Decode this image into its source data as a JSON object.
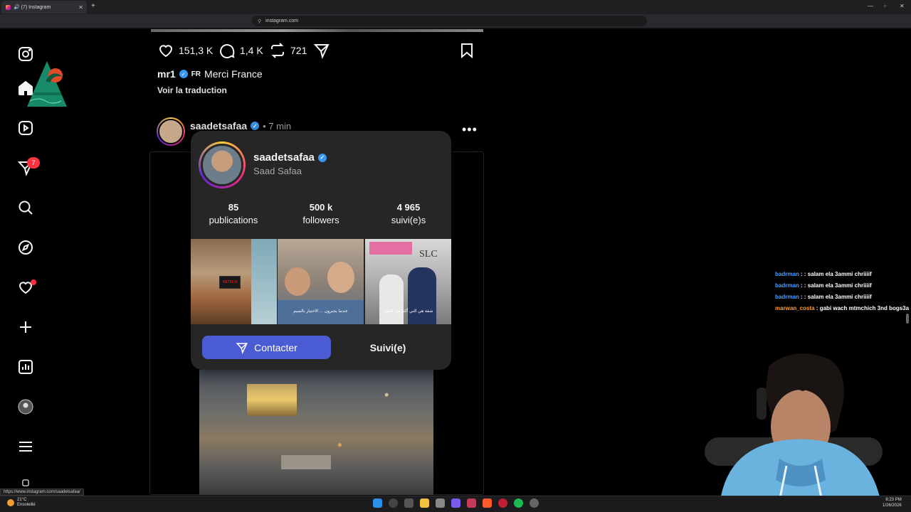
{
  "browser": {
    "tab_title": "🔊 (7) Instagram",
    "url": "instagram.com",
    "status_link": "https://www.instagram.com/saadetsafaa/"
  },
  "sidebar": {
    "notification_badge": "7"
  },
  "post1": {
    "likes": "151,3 K",
    "comments": "1,4 K",
    "reposts": "721",
    "caption_user": "mr1",
    "caption_flag": "FR",
    "caption_text": "Merci France",
    "translate_link": "Voir la traduction"
  },
  "post2": {
    "username": "saadetsafaa",
    "time": "• 7 min",
    "more": "•••"
  },
  "hover_card": {
    "username": "saadetsafaa",
    "full_name": "Saad Safaa",
    "stats": [
      {
        "value": "85",
        "label": "publications"
      },
      {
        "value": "500 k",
        "label": "followers"
      },
      {
        "value": "4 965",
        "label": "suivi(e)s"
      }
    ],
    "thumbnail_captions": [
      "",
      "عندما يجبرون ... الاختيار بالسيم",
      "شقة هي التي أكثر من العقل"
    ],
    "netflix_label": "NETFLIX",
    "slc_label": "SLC",
    "contact_button": "Contacter",
    "following_button": "Suivi(e)"
  },
  "chat": [
    {
      "user": "badrman",
      "message": ": : salam ela 3ammi chriiiif",
      "color": "#4ea0ff"
    },
    {
      "user": "badrman",
      "message": ": : salam ela 3ammi chriiiif",
      "color": "#4ea0ff"
    },
    {
      "user": "badrman",
      "message": ": : salam ela 3ammi chriiiif",
      "color": "#4ea0ff"
    },
    {
      "user": "marwan_costa",
      "message": ": gabi wach mtmchich 3nd bogs3a",
      "color": "#ff9d2e"
    }
  ],
  "taskbar": {
    "temperature": "21°C",
    "weather": "Ensoleillé",
    "time": "8:23 PM",
    "date": "1/26/2026"
  }
}
